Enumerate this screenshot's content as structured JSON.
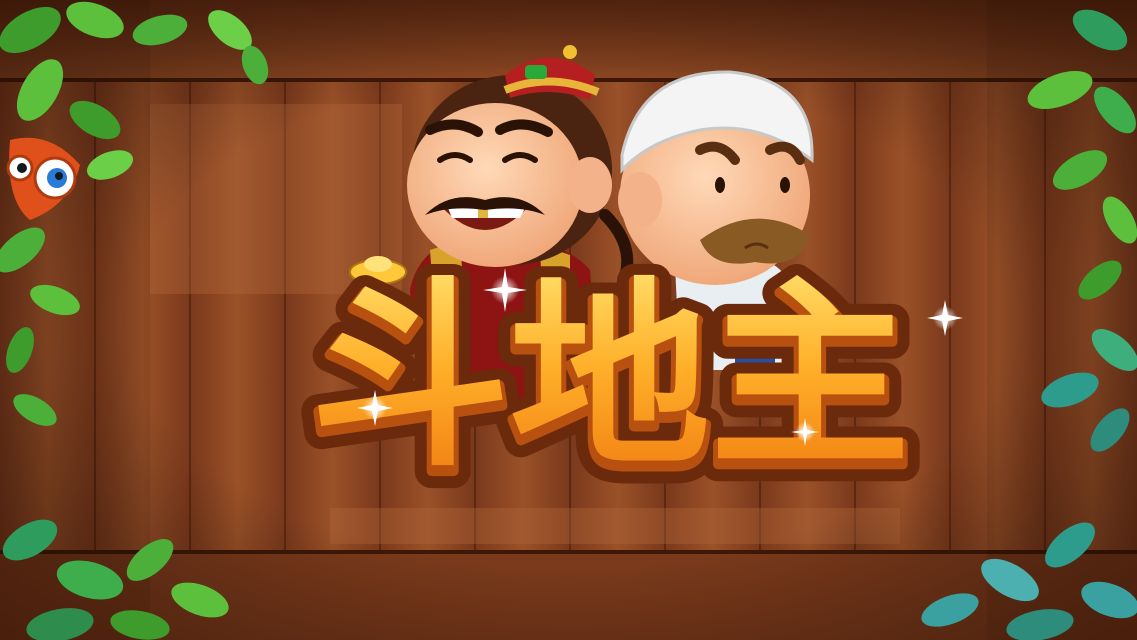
{
  "game": {
    "logo_text": "斗地主"
  },
  "colors": {
    "wood_dark": "#6b3219",
    "wood_mid": "#8a4724",
    "wood_light": "#a65a2e",
    "logo_orange": "#ff9a1a",
    "logo_yellow": "#ffd24a",
    "logo_outline": "#6b2a0c",
    "leaf_green": "#4caf3a",
    "leaf_teal": "#2e9c8c"
  },
  "icons": {
    "left_mascot": "bird-mascot-icon",
    "sparkle": "sparkle-icon"
  }
}
